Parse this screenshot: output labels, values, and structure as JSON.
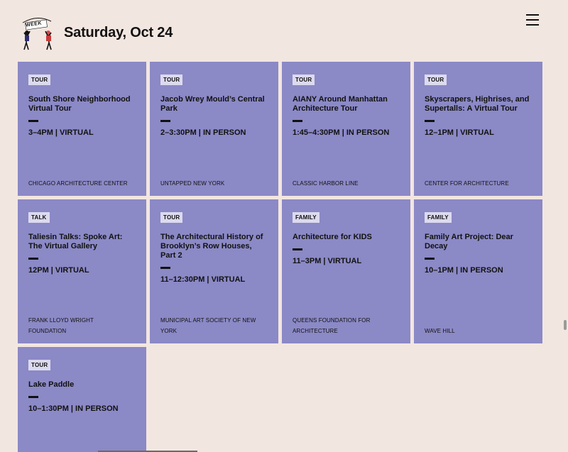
{
  "header": {
    "logo_text": "WEEK",
    "date_title": "Saturday, Oct 24"
  },
  "events": [
    {
      "tag": "TOUR",
      "title": "South Shore Neighborhood Virtual Tour",
      "time": "3–4PM | VIRTUAL",
      "org": "CHICAGO ARCHITECTURE CENTER"
    },
    {
      "tag": "TOUR",
      "title": "Jacob Wrey Mould’s Central Park",
      "time": "2–3:30PM | IN PERSON",
      "org": "UNTAPPED NEW YORK"
    },
    {
      "tag": "TOUR",
      "title": "AIANY Around Manhattan Architecture Tour",
      "time": "1:45–4:30PM | IN PERSON",
      "org": "CLASSIC HARBOR LINE"
    },
    {
      "tag": "TOUR",
      "title": "Skyscrapers, Highrises, and Supertalls: A Virtual Tour",
      "time": "12–1PM | VIRTUAL",
      "org": "CENTER FOR ARCHITECTURE"
    },
    {
      "tag": "TALK",
      "title": "Taliesin Talks: Spoke Art: The Virtual Gallery",
      "time": "12PM | VIRTUAL",
      "org": "FRANK LLOYD WRIGHT FOUNDATION"
    },
    {
      "tag": "TOUR",
      "title": "The Architectural History of Brooklyn’s Row Houses, Part 2",
      "time": "11–12:30PM | VIRTUAL",
      "org": "MUNICIPAL ART SOCIETY OF NEW YORK"
    },
    {
      "tag": "FAMILY",
      "title": "Architecture for KIDS",
      "time": "11–3PM | VIRTUAL",
      "org": "QUEENS FOUNDATION FOR ARCHITECTURE"
    },
    {
      "tag": "FAMILY",
      "title": "Family Art Project: Dear Decay",
      "time": "10–1PM | IN PERSON",
      "org": "WAVE HILL"
    },
    {
      "tag": "TOUR",
      "title": "Lake Paddle",
      "time": "10–1:30PM | IN PERSON",
      "org": ""
    }
  ],
  "colors": {
    "background": "#f2e6e0",
    "card": "#8b89c6",
    "tag": "#dcdaee"
  }
}
